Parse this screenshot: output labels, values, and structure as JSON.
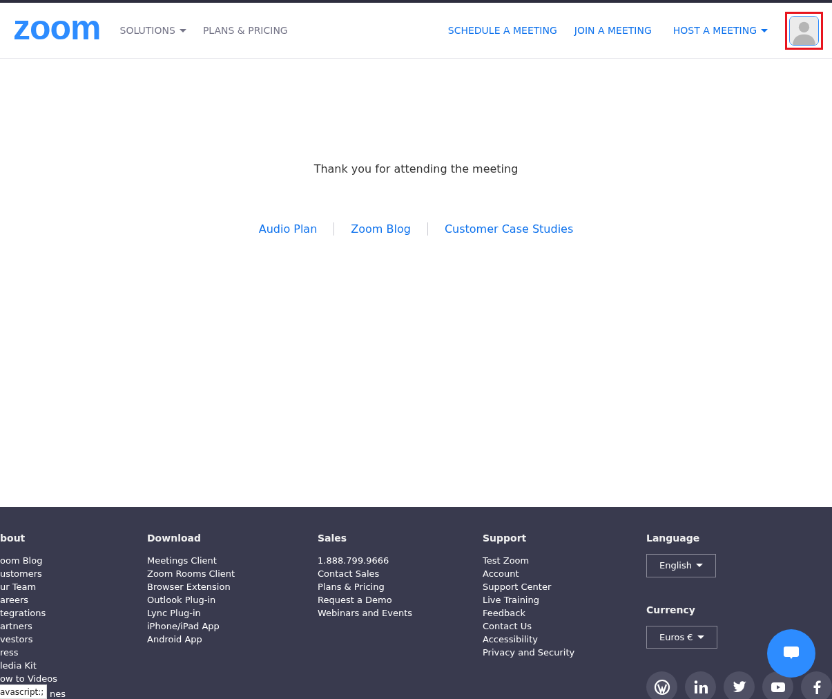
{
  "header": {
    "logo": "zoom",
    "nav_left": [
      {
        "label": "SOLUTIONS",
        "dropdown": true
      },
      {
        "label": "PLANS & PRICING",
        "dropdown": false
      }
    ],
    "nav_right": [
      {
        "label": "SCHEDULE A MEETING",
        "dropdown": false
      },
      {
        "label": "JOIN A MEETING",
        "dropdown": false
      },
      {
        "label": "HOST A MEETING",
        "dropdown": true
      }
    ],
    "avatar": {
      "highlighted": true
    }
  },
  "main": {
    "message": "Thank you for attending the meeting",
    "links": [
      "Audio Plan",
      "Zoom Blog",
      "Customer Case Studies"
    ]
  },
  "footer": {
    "columns": [
      {
        "heading": "bout",
        "links": [
          "oom Blog",
          "ustomers",
          "ur Team",
          "areers",
          "tegrations",
          "artners",
          "vestors",
          "ress",
          "ledia Kit",
          "ow to Videos",
          "nes"
        ]
      },
      {
        "heading": "Download",
        "links": [
          "Meetings Client",
          "Zoom Rooms Client",
          "Browser Extension",
          "Outlook Plug-in",
          "Lync Plug-in",
          "iPhone/iPad App",
          "Android App"
        ]
      },
      {
        "heading": "Sales",
        "links": [
          "1.888.799.9666",
          "Contact Sales",
          "Plans & Pricing",
          "Request a Demo",
          "Webinars and Events"
        ]
      },
      {
        "heading": "Support",
        "links": [
          "Test Zoom",
          "Account",
          "Support Center",
          "Live Training",
          "Feedback",
          "Contact Us",
          "Accessibility",
          "Privacy and Security"
        ]
      }
    ],
    "language": {
      "heading": "Language",
      "value": "English"
    },
    "currency": {
      "heading": "Currency",
      "value": "Euros €"
    },
    "social": [
      {
        "kind": "wordpress"
      },
      {
        "kind": "linkedin"
      },
      {
        "kind": "twitter"
      },
      {
        "kind": "youtube"
      },
      {
        "kind": "facebook"
      }
    ]
  },
  "status_tooltip": "avascript:;"
}
